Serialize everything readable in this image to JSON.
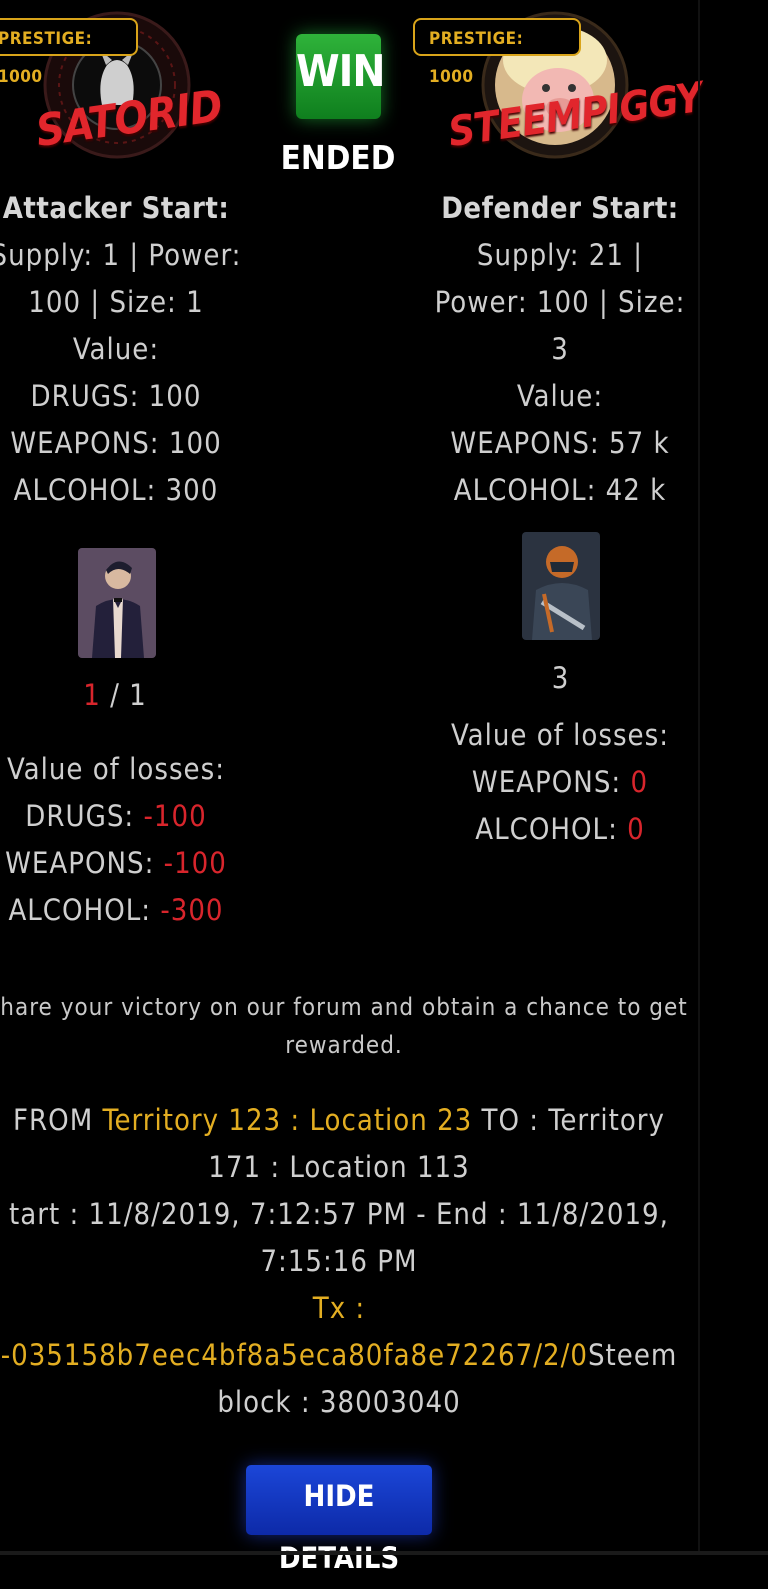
{
  "result": {
    "badge": "WIN",
    "status": "ENDED"
  },
  "attacker": {
    "prestige": "PRESTIGE: 1000",
    "name": "SATORID",
    "start_title": "Attacker Start:",
    "stats_line1": "Supply: 1 | Power:",
    "stats_line2": "100 | Size: 1",
    "value_label": "Value:",
    "values": [
      "DRUGS: 100",
      "WEAPONS: 100",
      "ALCOHOL: 300"
    ],
    "units_lost": "1",
    "units_total": "/ 1",
    "losses_title": "Value of losses:",
    "losses": [
      {
        "label": "DRUGS: ",
        "value": "-100"
      },
      {
        "label": "WEAPONS: ",
        "value": "-100"
      },
      {
        "label": "ALCOHOL: ",
        "value": "-300"
      }
    ]
  },
  "defender": {
    "prestige": "PRESTIGE: 1000",
    "name": "STEEMPIGGY",
    "start_title": "Defender Start:",
    "stats_line1": "Supply: 21 |",
    "stats_line2": "Power: 100 | Size:",
    "stats_line3": "3",
    "value_label": "Value:",
    "values": [
      "WEAPONS: 57 k",
      "ALCOHOL: 42 k"
    ],
    "units": "3",
    "losses_title": "Value of losses:",
    "losses": [
      {
        "label": "WEAPONS: ",
        "value": "0"
      },
      {
        "label": "ALCOHOL: ",
        "value": "0"
      }
    ]
  },
  "share": {
    "line1": "hare your victory on our forum and obtain a chance to get",
    "line2": "rewarded."
  },
  "route": {
    "from_label": "FROM ",
    "from_value": "Territory 123 : Location 23",
    "to_label": " TO : Territory",
    "line2": "171 : Location 113",
    "time_line1": "tart : 11/8/2019, 7:12:57 PM - End : 11/8/2019,",
    "time_line2": "7:15:16 PM",
    "tx_label": "Tx :",
    "tx_value": "-035158b7eec4bf8a5eca80fa8e72267/2/0",
    "block_prefix": "Steem",
    "block_line2": "block : 38003040"
  },
  "hide_button": "HIDE DETAILS",
  "colors": {
    "accent_gold": "#e3ae22",
    "loss_red": "#d8252c",
    "win_green": "#1f9a2b",
    "button_blue": "#1538c4"
  }
}
